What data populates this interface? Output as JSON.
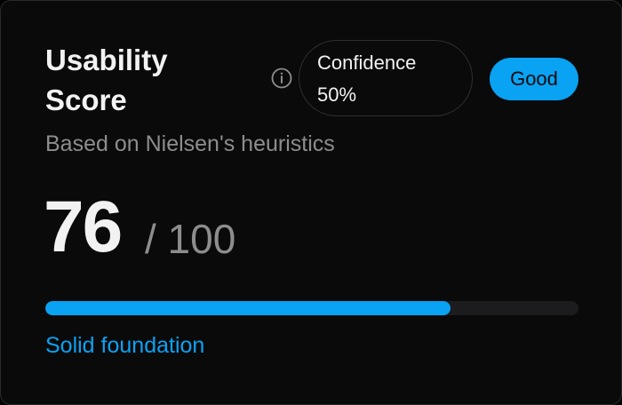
{
  "card": {
    "title": "Usability Score",
    "subtitle": "Based on Nielsen's heuristics",
    "confidence": {
      "label": "Confidence",
      "value": "50%"
    },
    "badge": "Good",
    "score": "76",
    "score_max": "/ 100",
    "progress_fraction": 0.76,
    "verdict": "Solid foundation",
    "icons": {
      "info": "info-icon"
    },
    "colors": {
      "accent": "#0aa2f2",
      "background": "#0a0a0b",
      "text": "#f2f2f2",
      "muted": "#8d8d8d",
      "track": "#1c1c1e"
    }
  }
}
